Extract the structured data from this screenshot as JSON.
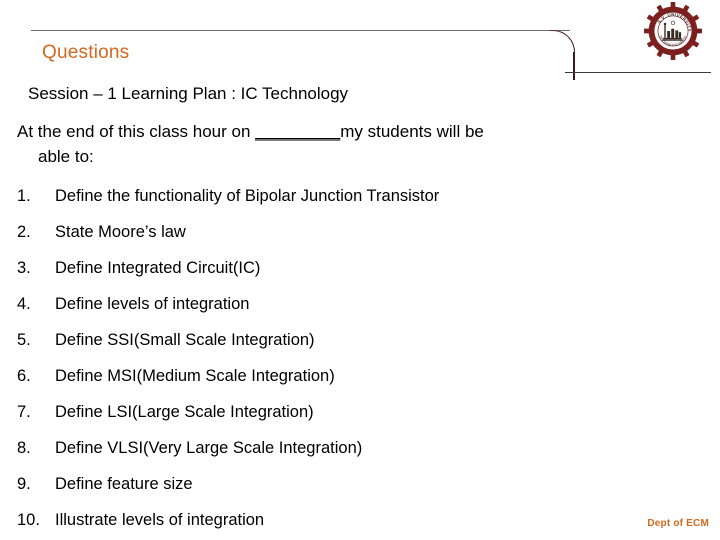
{
  "slide": {
    "title": "Questions",
    "title_color": "#D2691E",
    "session_line": "Session – 1  Learning Plan :  IC Technology",
    "intro": {
      "before_blank": "At the end of this class hour on ",
      "blank": "_________",
      "after_blank": "my students will be",
      "line2": "able to:"
    },
    "objectives": [
      {
        "number": "1.",
        "text": "Define the functionality of Bipolar Junction Transistor"
      },
      {
        "number": "2.",
        "text": "State  Moore’s  law"
      },
      {
        "number": "3.",
        "text": "Define Integrated Circuit(IC)"
      },
      {
        "number": "4.",
        "text": "Define levels of integration"
      },
      {
        "number": "5.",
        "text": "Define SSI(Small Scale Integration)"
      },
      {
        "number": "6.",
        "text": "Define MSI(Medium Scale Integration)"
      },
      {
        "number": "7.",
        "text": "Define LSI(Large Scale Integration)"
      },
      {
        "number": "8.",
        "text": "Define VLSI(Very Large  Scale Integration)"
      },
      {
        "number": "9.",
        "text": "Define feature size"
      },
      {
        "number": "10.",
        "text": "Illustrate levels of integration"
      }
    ],
    "footer": "Dept of ECM",
    "footer_color": "#D2691E",
    "logo": {
      "name": "university-gear-logo",
      "color": "#7B1F1F",
      "top_text": "S.V. UNIVERSITY",
      "bottom_text": "SRI VENKATESWARA"
    }
  }
}
